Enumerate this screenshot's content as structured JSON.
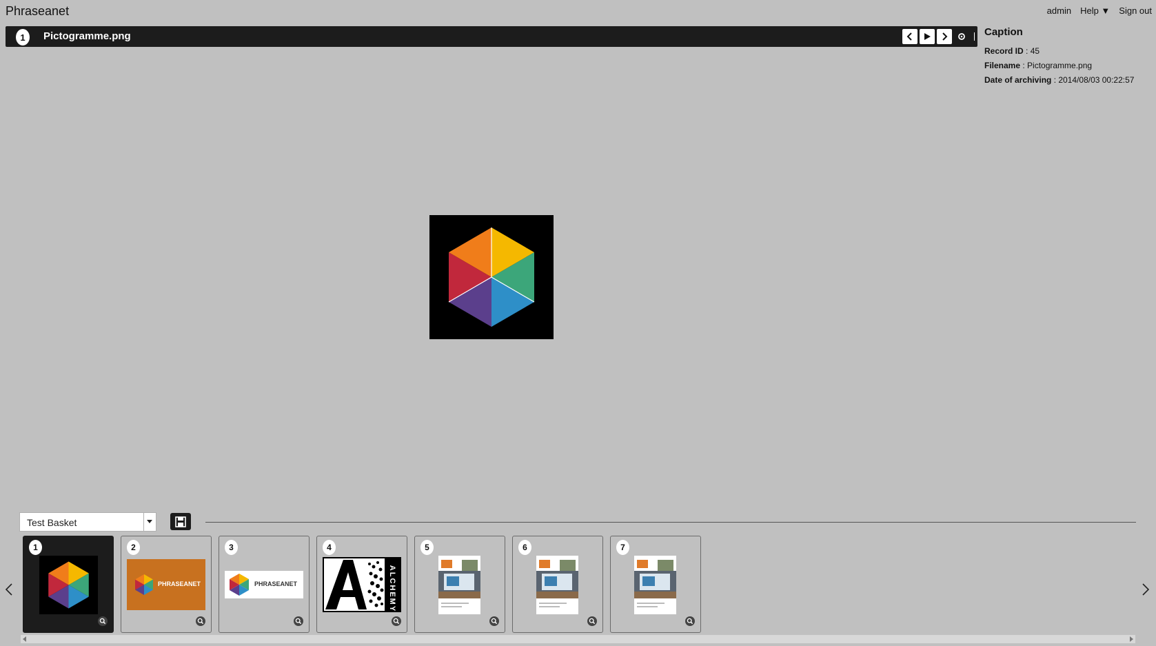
{
  "app": {
    "title": "Phraseanet"
  },
  "topnav": {
    "user": "admin",
    "help": "Help ▼",
    "signout": "Sign out"
  },
  "viewer": {
    "index": "1",
    "filename": "Pictogramme.png"
  },
  "caption": {
    "title": "Caption",
    "fields": [
      {
        "label": "Record ID",
        "value": " : 45"
      },
      {
        "label": "Filename",
        "value": " : Pictogramme.png"
      },
      {
        "label": "Date of archiving",
        "value": " : 2014/08/03 00:22:57"
      }
    ]
  },
  "basket": {
    "selected": "Test Basket"
  },
  "thumbnails": [
    {
      "num": "1",
      "kind": "cube"
    },
    {
      "num": "2",
      "kind": "phraseanet-orange",
      "text": "PHRASEANET"
    },
    {
      "num": "3",
      "kind": "phraseanet-white",
      "text": "PHRASEANET"
    },
    {
      "num": "4",
      "kind": "alchemy",
      "text": "ALCHEMY"
    },
    {
      "num": "5",
      "kind": "brochure"
    },
    {
      "num": "6",
      "kind": "brochure"
    },
    {
      "num": "7",
      "kind": "brochure"
    }
  ],
  "icons": {
    "prev": "chevron-left-icon",
    "play": "play-icon",
    "next": "chevron-right-icon",
    "settings": "settings-icon",
    "save": "save-icon",
    "zoom": "zoom-icon"
  },
  "colors": {
    "bar": "#1c1c1c",
    "background": "#c0c0c0",
    "orange": "#c8711f"
  }
}
